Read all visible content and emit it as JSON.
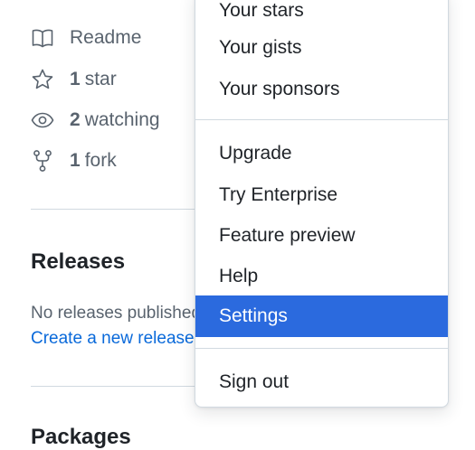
{
  "sidebar": {
    "readme": {
      "label": "Readme",
      "icon": "book-icon"
    },
    "stars": {
      "count": "1",
      "label": "star",
      "icon": "star-icon"
    },
    "watching": {
      "count": "2",
      "label": "watching",
      "icon": "eye-icon"
    },
    "forks": {
      "count": "1",
      "label": "fork",
      "icon": "repo-forked-icon"
    }
  },
  "releases": {
    "title": "Releases",
    "empty_text": "No releases published",
    "create_link": "Create a new release"
  },
  "packages": {
    "title": "Packages"
  },
  "user_menu": {
    "group_top": [
      "Your stars",
      "Your gists",
      "Your sponsors"
    ],
    "group_middle": [
      "Upgrade",
      "Try Enterprise",
      "Feature preview",
      "Help",
      "Settings"
    ],
    "group_bottom": [
      "Sign out"
    ],
    "highlighted_item": "Settings",
    "highlight_color": "#2b6ade"
  },
  "colors": {
    "link": "#0969da",
    "muted_text": "#59636e",
    "primary_text": "#1f2328",
    "border": "#d1d9e0"
  }
}
